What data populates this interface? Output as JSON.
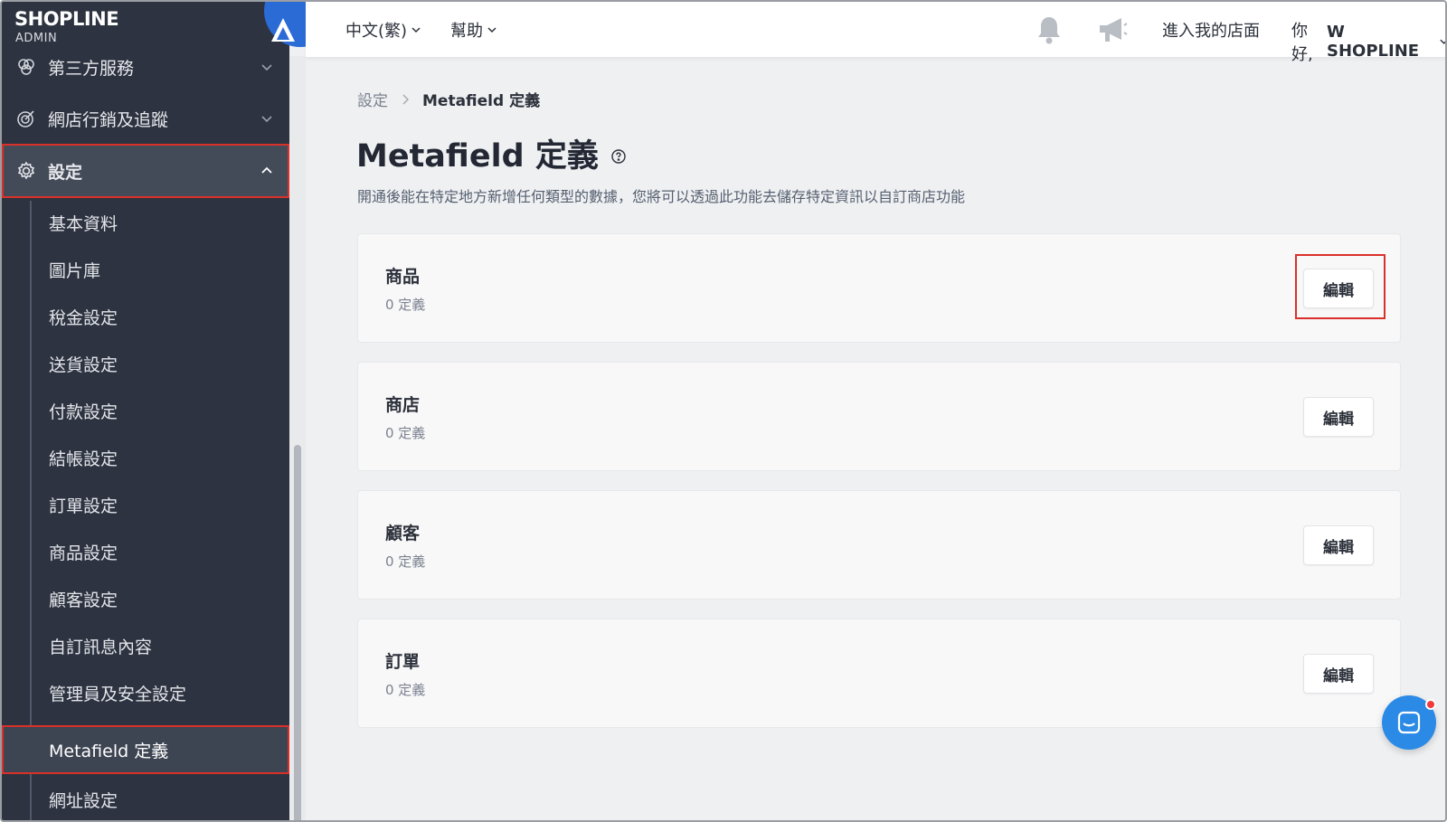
{
  "brand": {
    "logo": "SHOPLINE",
    "sub": "ADMIN"
  },
  "sidebar": {
    "items": [
      {
        "label": "第三方服務",
        "icon": "circles-icon"
      },
      {
        "label": "網店行銷及追蹤",
        "icon": "target-icon"
      },
      {
        "label": "設定",
        "icon": "gear-icon",
        "expanded": true
      }
    ],
    "subitems": [
      "基本資料",
      "圖片庫",
      "稅金設定",
      "送貨設定",
      "付款設定",
      "結帳設定",
      "訂單設定",
      "商品設定",
      "顧客設定",
      "自訂訊息內容",
      "管理員及安全設定",
      "Metafield 定義",
      "網址設定"
    ],
    "active_subitem": "Metafield 定義"
  },
  "topbar": {
    "language": "中文(繁)",
    "help": "幫助",
    "store_link": "進入我的店面",
    "greeting_prefix": "你好, ",
    "greeting_name": "W SHOPLINE"
  },
  "breadcrumb": {
    "parent": "設定",
    "current": "Metafield 定義"
  },
  "page": {
    "title": "Metafield 定義",
    "description": "開通後能在特定地方新增任何類型的數據，您將可以透過此功能去儲存特定資訊以自訂商店功能"
  },
  "cards": [
    {
      "title": "商品",
      "count": "0 定義",
      "button": "編輯"
    },
    {
      "title": "商店",
      "count": "0 定義",
      "button": "編輯"
    },
    {
      "title": "顧客",
      "count": "0 定義",
      "button": "編輯"
    },
    {
      "title": "訂單",
      "count": "0 定義",
      "button": "編輯"
    }
  ],
  "colors": {
    "accent": "#2a6bd6",
    "highlight": "#d9312a",
    "sidebar": "#2d3340",
    "chat": "#2b8ae6"
  }
}
